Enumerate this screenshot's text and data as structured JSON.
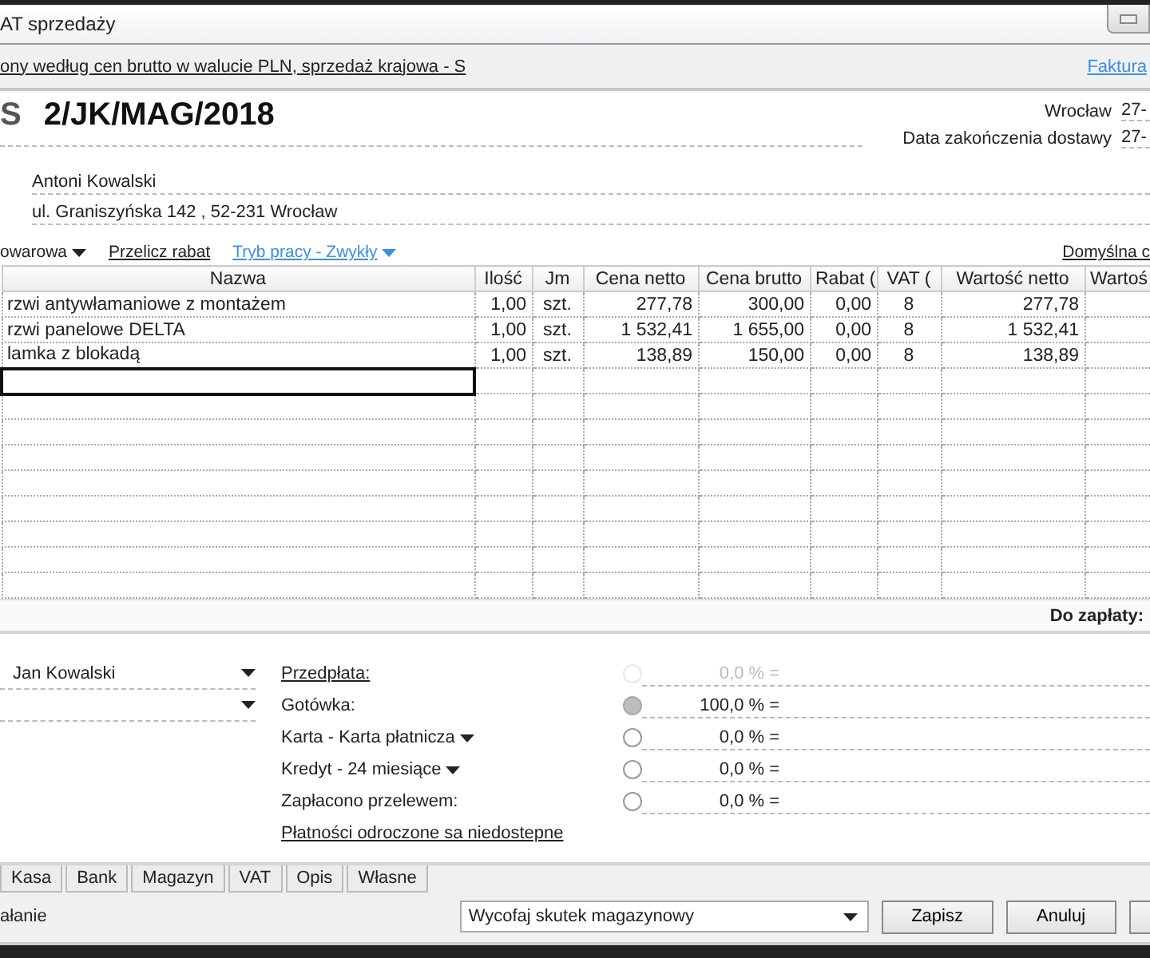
{
  "window": {
    "title": "AT sprzedaży"
  },
  "info_bar": {
    "description": "ony według cen brutto w walucie PLN, sprzedaż krajowa - S",
    "link": "Faktura"
  },
  "document": {
    "prefix": "S",
    "number": "2/JK/MAG/2018",
    "place_label": "Wrocław",
    "place_date": "27-",
    "delivery_label": "Data zakończenia dostawy",
    "delivery_date": "27-",
    "buyer": "Antoni Kowalski",
    "address": "ul. Graniszyńska 142 , 52-231 Wrocław"
  },
  "toolbar": [
    {
      "kind": "menu",
      "label": "owarowa"
    },
    {
      "kind": "link",
      "label": "Przelicz rabat"
    },
    {
      "kind": "mode",
      "label": "Tryb pracy - Zwykły"
    }
  ],
  "toolbar_right": "Domyślna c",
  "table": {
    "columns": [
      "Nazwa",
      "Ilość",
      "Jm",
      "Cena netto",
      "Cena brutto",
      "Rabat (",
      "VAT (",
      "Wartość netto",
      "Wartoś"
    ],
    "rows": [
      [
        "rzwi antywłamaniowe z montażem",
        "1,00",
        "szt.",
        "277,78",
        "300,00",
        "0,00",
        "8",
        "277,78"
      ],
      [
        "rzwi panelowe DELTA",
        "1,00",
        "szt.",
        "1 532,41",
        "1 655,00",
        "0,00",
        "8",
        "1 532,41"
      ],
      [
        "lamka z blokadą",
        "1,00",
        "szt.",
        "138,89",
        "150,00",
        "0,00",
        "8",
        "138,89"
      ]
    ]
  },
  "total_label": "Do zapłaty:",
  "payments": {
    "seller": "Jan Kowalski",
    "methods": [
      {
        "kind": "link",
        "label": "Przedpłata:",
        "selected": false,
        "disabled": true,
        "percent": "0,0 % ="
      },
      {
        "kind": "label",
        "label": "Gotówka:",
        "selected": true,
        "disabled": false,
        "percent": "100,0 % ="
      },
      {
        "kind": "dropdown",
        "label": "Karta - Karta płatnicza",
        "selected": false,
        "disabled": false,
        "percent": "0,0 % ="
      },
      {
        "kind": "dropdown",
        "label": "Kredyt - 24 miesiące",
        "selected": false,
        "disabled": false,
        "percent": "0,0 % ="
      },
      {
        "kind": "label",
        "label": "Zapłacono przelewem:",
        "selected": false,
        "disabled": false,
        "percent": "0,0 % ="
      }
    ],
    "note": "Płatności odroczone sa niedostepne"
  },
  "tabs": [
    {
      "label": "Kasa",
      "selected": false
    },
    {
      "label": "Bank",
      "selected": false
    },
    {
      "label": "Magazyn",
      "selected": false
    },
    {
      "label": "VAT",
      "selected": false
    },
    {
      "label": "Opis",
      "selected": false
    },
    {
      "label": "Własne",
      "selected": false
    }
  ],
  "status": "ałanie",
  "action_dropdown": "Wycofaj skutek magazynowy",
  "buttons": [
    "Zapisz",
    "Anuluj"
  ]
}
